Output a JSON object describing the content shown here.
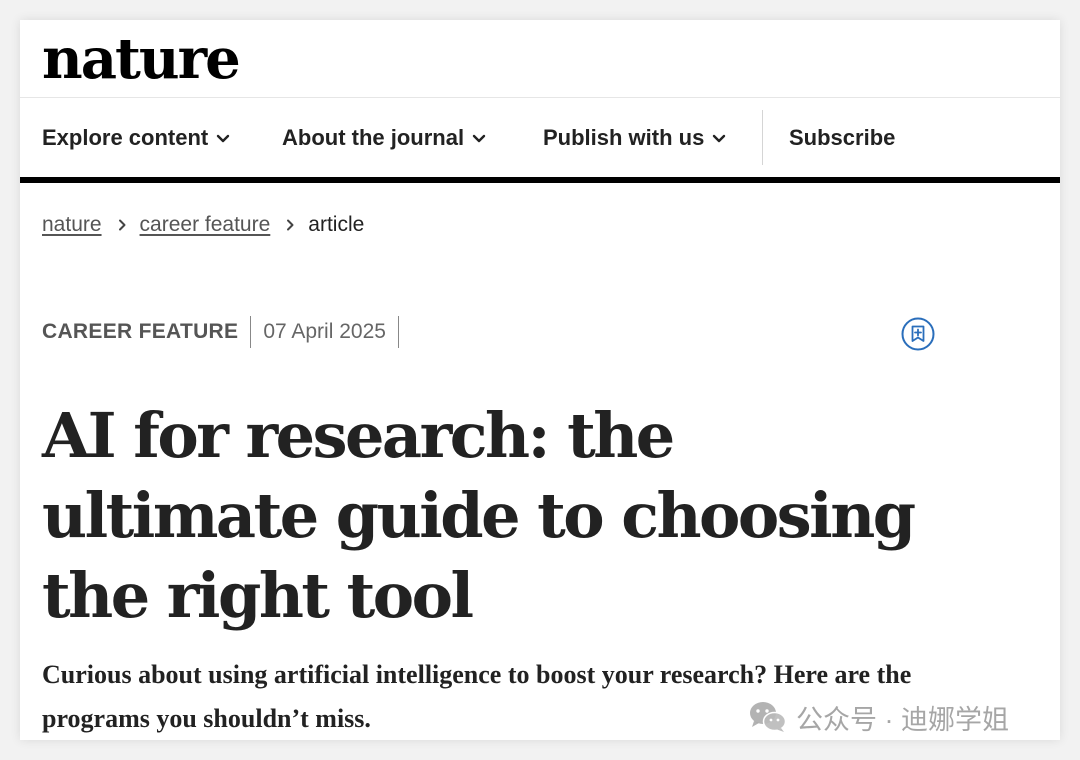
{
  "site": {
    "logo": "nature"
  },
  "nav": {
    "items": [
      {
        "label": "Explore content",
        "has_dropdown": true
      },
      {
        "label": "About the journal",
        "has_dropdown": true
      },
      {
        "label": "Publish with us",
        "has_dropdown": true
      },
      {
        "label": "Subscribe",
        "has_dropdown": false
      }
    ]
  },
  "breadcrumb": {
    "items": [
      "nature",
      "career feature",
      "article"
    ]
  },
  "article": {
    "type": "CAREER FEATURE",
    "date": "07 April 2025",
    "title": "AI for research: the ultimate guide to choosing the right tool",
    "standfirst": "Curious about using artificial intelligence to boost your research? Here are the programs you shouldn’t miss."
  },
  "watermark": {
    "text": "公众号 · 迪娜学姐",
    "icon": "wechat-icon"
  },
  "icons": {
    "bookmark": "bookmark-add-icon",
    "chevron": "chevron-down-icon",
    "separator": "chevron-right-icon"
  },
  "colors": {
    "text": "#222222",
    "nav_rule": "#000000",
    "bookmark_accent": "#2a6ebb",
    "muted": "#555555"
  }
}
